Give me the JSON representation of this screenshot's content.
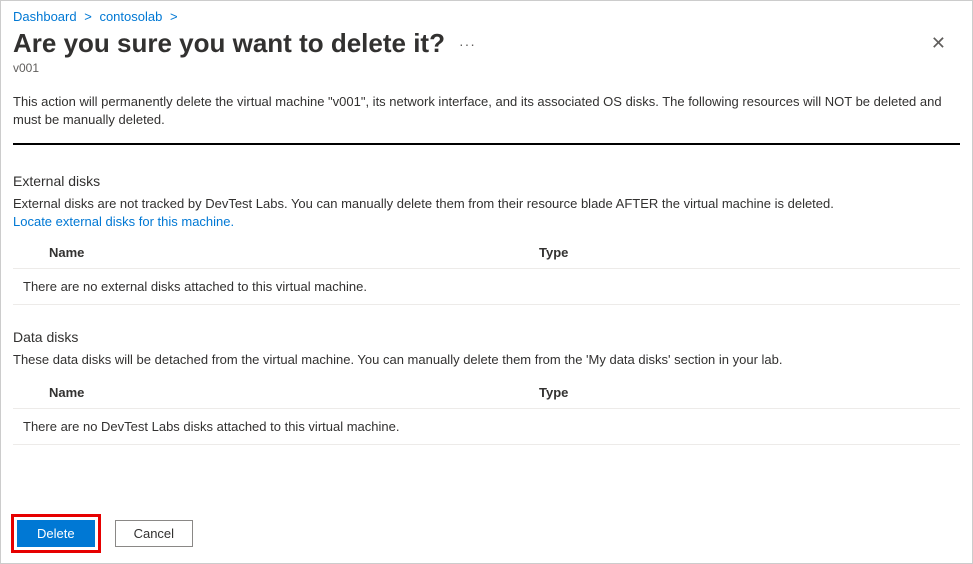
{
  "breadcrumb": {
    "items": [
      "Dashboard",
      "contosolab"
    ],
    "sep": ">"
  },
  "header": {
    "title": "Are you sure you want to delete it?",
    "subtitle": "v001"
  },
  "warning": "This action will permanently delete the virtual machine \"v001\", its network interface, and its associated OS disks. The following resources will NOT be deleted and must be manually deleted.",
  "sections": {
    "external": {
      "title": "External disks",
      "desc": "External disks are not tracked by DevTest Labs. You can manually delete them from their resource blade AFTER the virtual machine is deleted.",
      "link": "Locate external disks for this machine.",
      "col_name": "Name",
      "col_type": "Type",
      "empty": "There are no external disks attached to this virtual machine."
    },
    "data": {
      "title": "Data disks",
      "desc": "These data disks will be detached from the virtual machine. You can manually delete them from the 'My data disks' section in your lab.",
      "col_name": "Name",
      "col_type": "Type",
      "empty": "There are no DevTest Labs disks attached to this virtual machine."
    }
  },
  "footer": {
    "delete": "Delete",
    "cancel": "Cancel"
  }
}
